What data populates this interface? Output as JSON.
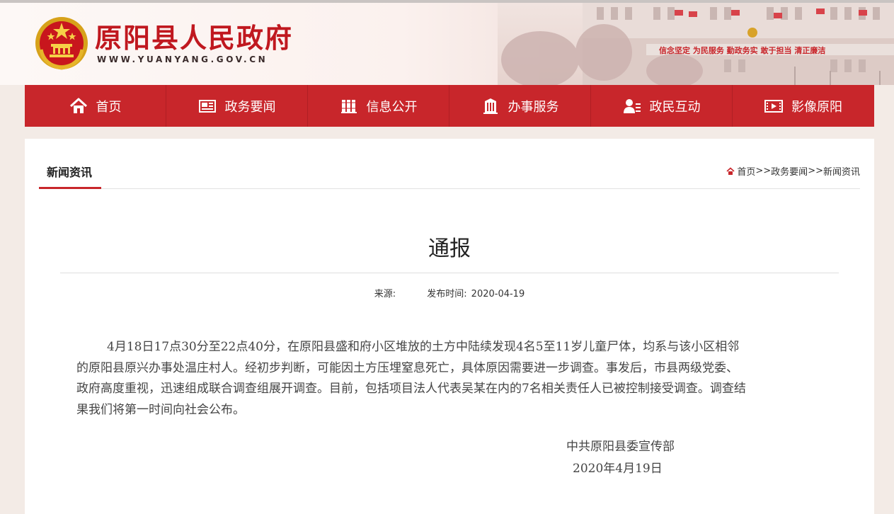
{
  "header": {
    "site_title": "原阳县人民政府",
    "site_url": "WWW.YUANYANG.GOV.CN",
    "banner_slogan": "信念坚定 为民服务 勤政务实 敢于担当 清正廉洁"
  },
  "nav": {
    "items": [
      {
        "label": "首页",
        "icon": "home-icon"
      },
      {
        "label": "政务要闻",
        "icon": "newspaper-icon"
      },
      {
        "label": "信息公开",
        "icon": "books-icon"
      },
      {
        "label": "办事服务",
        "icon": "building-icon"
      },
      {
        "label": "政民互动",
        "icon": "user-list-icon"
      },
      {
        "label": "影像原阳",
        "icon": "film-icon"
      }
    ]
  },
  "section": {
    "tab_label": "新闻资讯",
    "breadcrumb": {
      "home": "首页",
      "sep": ">>",
      "level2": "政务要闻",
      "level3": "新闻资讯"
    }
  },
  "article": {
    "title": "通报",
    "source_label": "来源:",
    "source_value": "",
    "date_label": "发布时间:",
    "date_value": "2020-04-19",
    "body": "4月18日17点30分至22点40分，在原阳县盛和府小区堆放的土方中陆续发现4名5至11岁儿童尸体，均系与该小区相邻的原阳县原兴办事处温庄村人。经初步判断，可能因土方压埋窒息死亡，具体原因需要进一步调查。事发后，市县两级党委、政府高度重视，迅速组成联合调查组展开调查。目前，包括项目法人代表吴某在内的7名相关责任人已被控制接受调查。调查结果我们将第一时间向社会公布。",
    "signature_org": "中共原阳县委宣传部",
    "signature_date": "2020年4月19日"
  },
  "colors": {
    "brand_red": "#c8262b",
    "title_red": "#c0181f",
    "page_bg": "#f3ebe6"
  }
}
